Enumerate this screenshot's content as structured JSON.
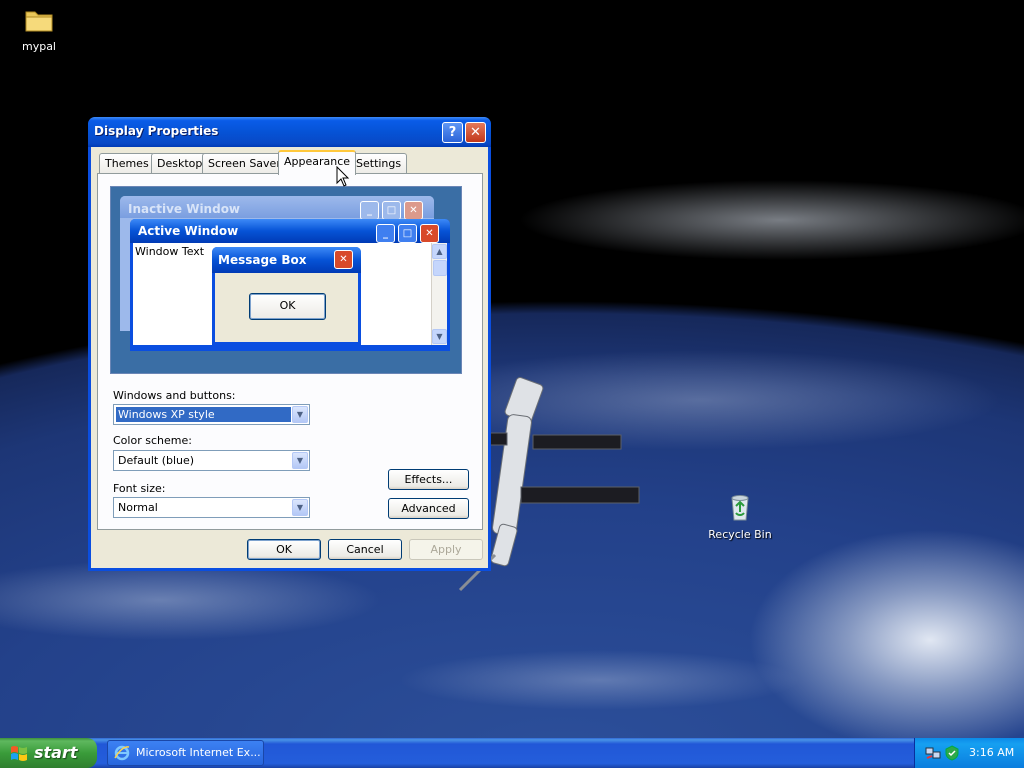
{
  "desktop": {
    "icons": [
      {
        "label": "mypal",
        "icon": "folder-icon"
      },
      {
        "label": "Recycle Bin",
        "icon": "recycle-bin-icon"
      }
    ]
  },
  "window": {
    "title": "Display Properties",
    "help_btn": "?",
    "close_btn": "✕",
    "tabs": [
      {
        "label": "Themes",
        "active": false
      },
      {
        "label": "Desktop",
        "active": false
      },
      {
        "label": "Screen Saver",
        "active": false
      },
      {
        "label": "Appearance",
        "active": true
      },
      {
        "label": "Settings",
        "active": false
      }
    ],
    "preview": {
      "inactive_title": "Inactive Window",
      "active_title": "Active Window",
      "window_text": "Window Text",
      "msgbox_title": "Message Box",
      "msgbox_ok": "OK"
    },
    "windows_buttons": {
      "label": "Windows and buttons:",
      "value": "Windows XP style"
    },
    "color_scheme": {
      "label": "Color scheme:",
      "value": "Default (blue)"
    },
    "font_size": {
      "label": "Font size:",
      "value": "Normal"
    },
    "effects_btn": "Effects...",
    "advanced_btn": "Advanced",
    "ok_btn": "OK",
    "cancel_btn": "Cancel",
    "apply_btn": "Apply"
  },
  "taskbar": {
    "start_label": "start",
    "tasks": [
      {
        "label": "Microsoft Internet Ex...",
        "icon": "internet-explorer-icon"
      }
    ],
    "clock": "3:16 AM"
  },
  "colors": {
    "titlebar_blue": "#0653d6",
    "dialog_face": "#ece9d8",
    "tab_highlight": "#ffc83c",
    "start_green": "#3a9c3a",
    "tray_blue": "#0c8ae8"
  }
}
